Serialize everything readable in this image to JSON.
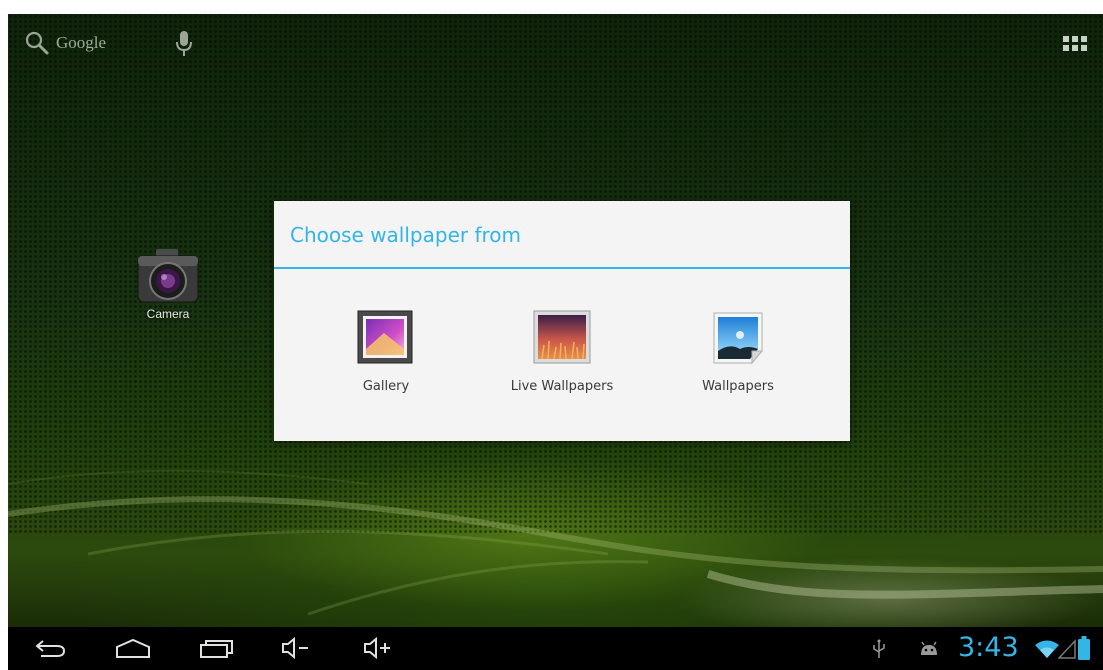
{
  "homescreen": {
    "search_hint": "Google",
    "apps": [
      {
        "label": "Camera",
        "icon": "camera-icon"
      }
    ]
  },
  "dialog": {
    "title": "Choose wallpaper from",
    "options": [
      {
        "label": "Gallery",
        "icon": "gallery-icon"
      },
      {
        "label": "Live Wallpapers",
        "icon": "live-wallpapers-icon"
      },
      {
        "label": "Wallpapers",
        "icon": "wallpapers-icon"
      }
    ]
  },
  "navbar": {
    "buttons": [
      "back-icon",
      "home-icon",
      "recent-apps-icon",
      "volume-down-icon",
      "volume-up-icon"
    ]
  },
  "status": {
    "time": "3:43",
    "icons": [
      "usb-icon",
      "android-debug-icon",
      "wifi-icon",
      "signal-icon",
      "battery-icon"
    ]
  },
  "colors": {
    "accent": "#33b5e5",
    "dialog_bg": "#f4f4f4",
    "navbar_bg": "#000000"
  }
}
